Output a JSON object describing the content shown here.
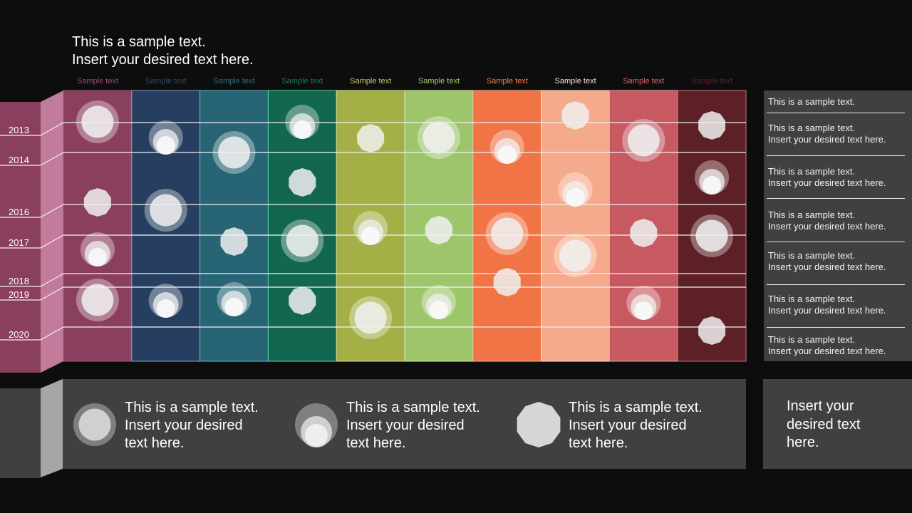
{
  "title": "This is a sample text.\nInsert your desired text here.",
  "columns": [
    {
      "label": "Sample text",
      "color": "#8b3f5f",
      "label_color": "#a34a6e",
      "border": "#a05a78"
    },
    {
      "label": "Sample text",
      "color": "#263f60",
      "label_color": "#2d4a6e",
      "border": "#8da6c8"
    },
    {
      "label": "Sample text",
      "color": "#276474",
      "label_color": "#2f7080",
      "border": "#6ab9c8"
    },
    {
      "label": "Sample text",
      "color": "#136650",
      "label_color": "#1a7a5e",
      "border": "#5fd6b0"
    },
    {
      "label": "Sample text",
      "color": "#a4b046",
      "label_color": "#c2cc70",
      "border": "#d6dd9a"
    },
    {
      "label": "Sample text",
      "color": "#9dc66a",
      "label_color": "#a7d070",
      "border": "#d8ecbe"
    },
    {
      "label": "Sample text",
      "color": "#f07446",
      "label_color": "#f47c50",
      "border": "#f6b89e"
    },
    {
      "label": "Sample text",
      "color": "#f6aa8c",
      "label_color": "#f4e2dc",
      "border": "#fbe2d8"
    },
    {
      "label": "Sample text",
      "color": "#c75a61",
      "label_color": "#d9646c",
      "border": "#e7a5a8"
    },
    {
      "label": "Sample text",
      "color": "#5c2026",
      "label_color": "#5a2228",
      "border": "#c9777e"
    }
  ],
  "years": [
    "2013",
    "2014",
    "2016",
    "2017",
    "2018",
    "2019",
    "2020"
  ],
  "markers": [
    {
      "col": 0,
      "row": 0,
      "type": "ring"
    },
    {
      "col": 0,
      "row": 2,
      "type": "poly"
    },
    {
      "col": 0,
      "row": 3,
      "type": "stack"
    },
    {
      "col": 0,
      "row": 5,
      "type": "ring"
    },
    {
      "col": 1,
      "row": 0,
      "type": "stack"
    },
    {
      "col": 1,
      "row": 2,
      "type": "ring"
    },
    {
      "col": 1,
      "row": 5,
      "type": "stack"
    },
    {
      "col": 2,
      "row": 1,
      "type": "ring"
    },
    {
      "col": 2,
      "row": 3,
      "type": "poly"
    },
    {
      "col": 2,
      "row": 5,
      "type": "stack"
    },
    {
      "col": 3,
      "row": 0,
      "type": "stack"
    },
    {
      "col": 3,
      "row": 1,
      "type": "poly"
    },
    {
      "col": 3,
      "row": 3,
      "type": "ring"
    },
    {
      "col": 3,
      "row": 5,
      "type": "poly"
    },
    {
      "col": 4,
      "row": 0,
      "type": "poly"
    },
    {
      "col": 4,
      "row": 3,
      "type": "stack"
    },
    {
      "col": 4,
      "row": 6,
      "type": "ring"
    },
    {
      "col": 5,
      "row": 0,
      "type": "ring"
    },
    {
      "col": 5,
      "row": 3,
      "type": "poly"
    },
    {
      "col": 5,
      "row": 5,
      "type": "stack"
    },
    {
      "col": 6,
      "row": 0,
      "type": "stack"
    },
    {
      "col": 6,
      "row": 3,
      "type": "ring"
    },
    {
      "col": 6,
      "row": 4,
      "type": "poly"
    },
    {
      "col": 7,
      "row": 0,
      "type": "poly"
    },
    {
      "col": 7,
      "row": 2,
      "type": "stack"
    },
    {
      "col": 7,
      "row": 3,
      "type": "ring"
    },
    {
      "col": 8,
      "row": 0,
      "type": "ring"
    },
    {
      "col": 8,
      "row": 3,
      "type": "poly"
    },
    {
      "col": 8,
      "row": 5,
      "type": "stack"
    },
    {
      "col": 9,
      "row": 0,
      "type": "poly"
    },
    {
      "col": 9,
      "row": 2,
      "type": "stack"
    },
    {
      "col": 9,
      "row": 3,
      "type": "ring"
    },
    {
      "col": 9,
      "row": 6,
      "type": "poly"
    }
  ],
  "right_panel": [
    "This is a sample text.",
    "This is a sample text.\nInsert your desired text here.",
    "This is a sample text.\nInsert your desired text here.",
    "This is a sample text.\nInsert your desired text here.",
    "This is a sample text.\nInsert your desired text here.",
    "This is a sample text.\nInsert your desired text here.",
    "This is a sample text.\nInsert your desired text here."
  ],
  "legend": [
    {
      "icon": "ring",
      "text": "This is a sample text.\nInsert your desired\ntext here."
    },
    {
      "icon": "stack",
      "text": "This is a sample text.\nInsert your desired\ntext here."
    },
    {
      "icon": "poly",
      "text": "This is a sample text.\nInsert your desired\ntext here."
    }
  ],
  "bottom_right_text": "Insert your\ndesired text\nhere.",
  "colors": {
    "background": "#0d0d0d",
    "panel": "#404040",
    "year_bar_front": "#8b3f5f",
    "year_bar_side": "#c27b9a",
    "bottom_side": "#a6a6a6"
  }
}
